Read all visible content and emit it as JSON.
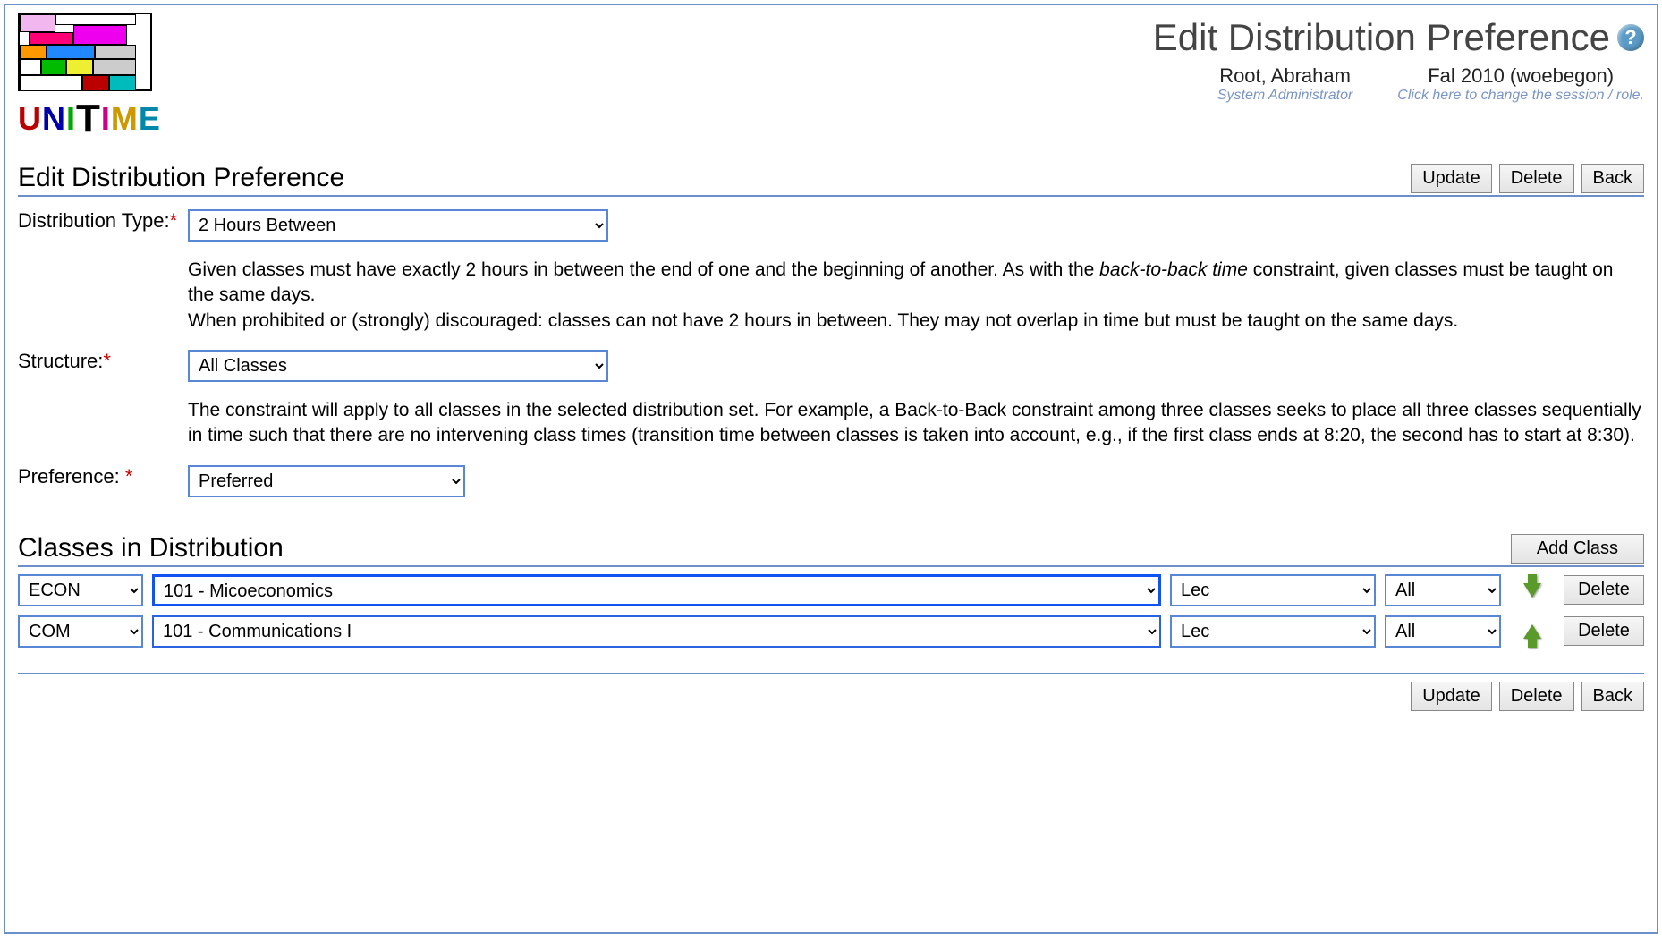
{
  "header": {
    "page_title": "Edit Distribution Preference",
    "user": {
      "name": "Root, Abraham",
      "role": "System Administrator"
    },
    "session": {
      "label": "Fal 2010 (woebegon)",
      "hint": "Click here to change the session / role."
    }
  },
  "logo_word": {
    "u": "U",
    "n": "N",
    "i": "I",
    "t": "T",
    "i2": "I",
    "m": "M",
    "e": "E"
  },
  "buttons": {
    "update": "Update",
    "delete": "Delete",
    "back": "Back",
    "add_class": "Add Class",
    "row_delete": "Delete"
  },
  "section_titles": {
    "main": "Edit Distribution Preference",
    "classes": "Classes in Distribution"
  },
  "form": {
    "dist_type": {
      "label": "Distribution Type:",
      "value": "2 Hours Between",
      "desc_1": "Given classes must have exactly 2 hours in between the end of one and the beginning of another. As with the ",
      "desc_em": "back-to-back time",
      "desc_2": " constraint, given classes must be taught on the same days.",
      "desc_3": "When prohibited or (strongly) discouraged: classes can not have 2 hours in between. They may not overlap in time but must be taught on the same days."
    },
    "structure": {
      "label": "Structure:",
      "value": "All Classes",
      "desc": "The constraint will apply to all classes in the selected distribution set. For example, a Back-to-Back constraint among three classes seeks to place all three classes sequentially in time such that there are no intervening class times (transition time between classes is taken into account, e.g., if the first class ends at 8:20, the second has to start at 8:30)."
    },
    "preference": {
      "label": "Preference: ",
      "value": "Preferred"
    }
  },
  "classes": [
    {
      "subject": "ECON",
      "course": "101 - Micoeconomics",
      "type": "Lec",
      "section": "All",
      "focused": true,
      "arrow": "down"
    },
    {
      "subject": "COM",
      "course": "101 - Communications I",
      "type": "Lec",
      "section": "All",
      "focused": false,
      "arrow": "up"
    }
  ]
}
